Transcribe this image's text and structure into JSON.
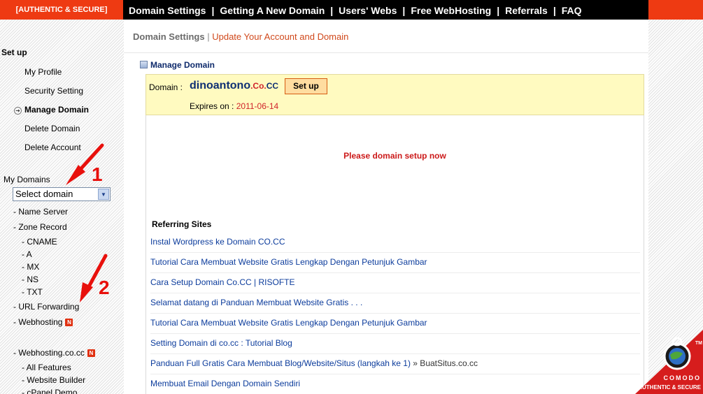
{
  "topbar": {
    "brand": "[AUTHENTIC & SECURE]",
    "nav": [
      "Domain Settings",
      "Getting A New Domain",
      "Users' Webs",
      "Free WebHosting",
      "Referrals",
      "FAQ"
    ],
    "separator": "|"
  },
  "sidebar": {
    "setup_heading": "Set up",
    "setup_items": [
      "My Profile",
      "Security Setting",
      "Manage Domain",
      "Delete Domain",
      "Delete Account"
    ],
    "active_item": "Manage Domain",
    "my_domains_label": "My Domains",
    "select_value": "Select domain",
    "tree": {
      "name_server": "- Name Server",
      "zone_record": "- Zone Record",
      "cname": "- CNAME",
      "a": "- A",
      "mx": "- MX",
      "ns": "- NS",
      "txt": "- TXT",
      "url_forwarding": "- URL Forwarding",
      "webhosting": "- Webhosting",
      "webhosting_cocc": "- Webhosting.co.cc",
      "all_features": "- All Features",
      "website_builder": "- Website Builder",
      "cpanel_demo": "- cPanel Demo"
    },
    "badge": "N"
  },
  "annotations": [
    "1",
    "2"
  ],
  "breadcrumb": {
    "section": "Domain Settings",
    "separator": "|",
    "current": "Update Your Account and Domain"
  },
  "manage_domain": {
    "title": "Manage Domain",
    "domain_label": "Domain :",
    "domain_name": "dinoantono",
    "domain_co": ".Co.",
    "domain_cc": "CC",
    "setup_button": "Set up",
    "expires_label": "Expires on :",
    "expires_date": "2011-06-14"
  },
  "notice": "Please domain setup now",
  "referring": {
    "title": "Referring Sites",
    "items": [
      {
        "text": "Instal Wordpress ke Domain CO.CC",
        "suffix": ""
      },
      {
        "text": "Tutorial Cara Membuat Website Gratis Lengkap Dengan Petunjuk Gambar",
        "suffix": ""
      },
      {
        "text": "Cara Setup Domain Co.CC | RISOFTE",
        "suffix": ""
      },
      {
        "text": "Selamat datang di Panduan Membuat Website Gratis . . .",
        "suffix": ""
      },
      {
        "text": "Tutorial Cara Membuat Website Gratis Lengkap Dengan Petunjuk Gambar",
        "suffix": ""
      },
      {
        "text": "Setting Domain di co.cc : Tutorial Blog",
        "suffix": ""
      },
      {
        "text": "Panduan Full Gratis Cara Membuat Blog/Website/Situs (langkah ke 1)",
        "suffix": " » BuatSitus.co.cc"
      },
      {
        "text": "Membuat Email Dengan Domain Sendiri",
        "suffix": ""
      }
    ]
  },
  "seal": {
    "brand": "COMODO",
    "tagline": "AUTHENTIC & SECURE",
    "tm": "TM"
  },
  "colors": {
    "accent_orange": "#ee3a12",
    "link_blue": "#0c3c9c",
    "highlight_yellow": "#fffac0",
    "notice_red": "#cc1a1a",
    "annotation_red": "#e8100c"
  }
}
